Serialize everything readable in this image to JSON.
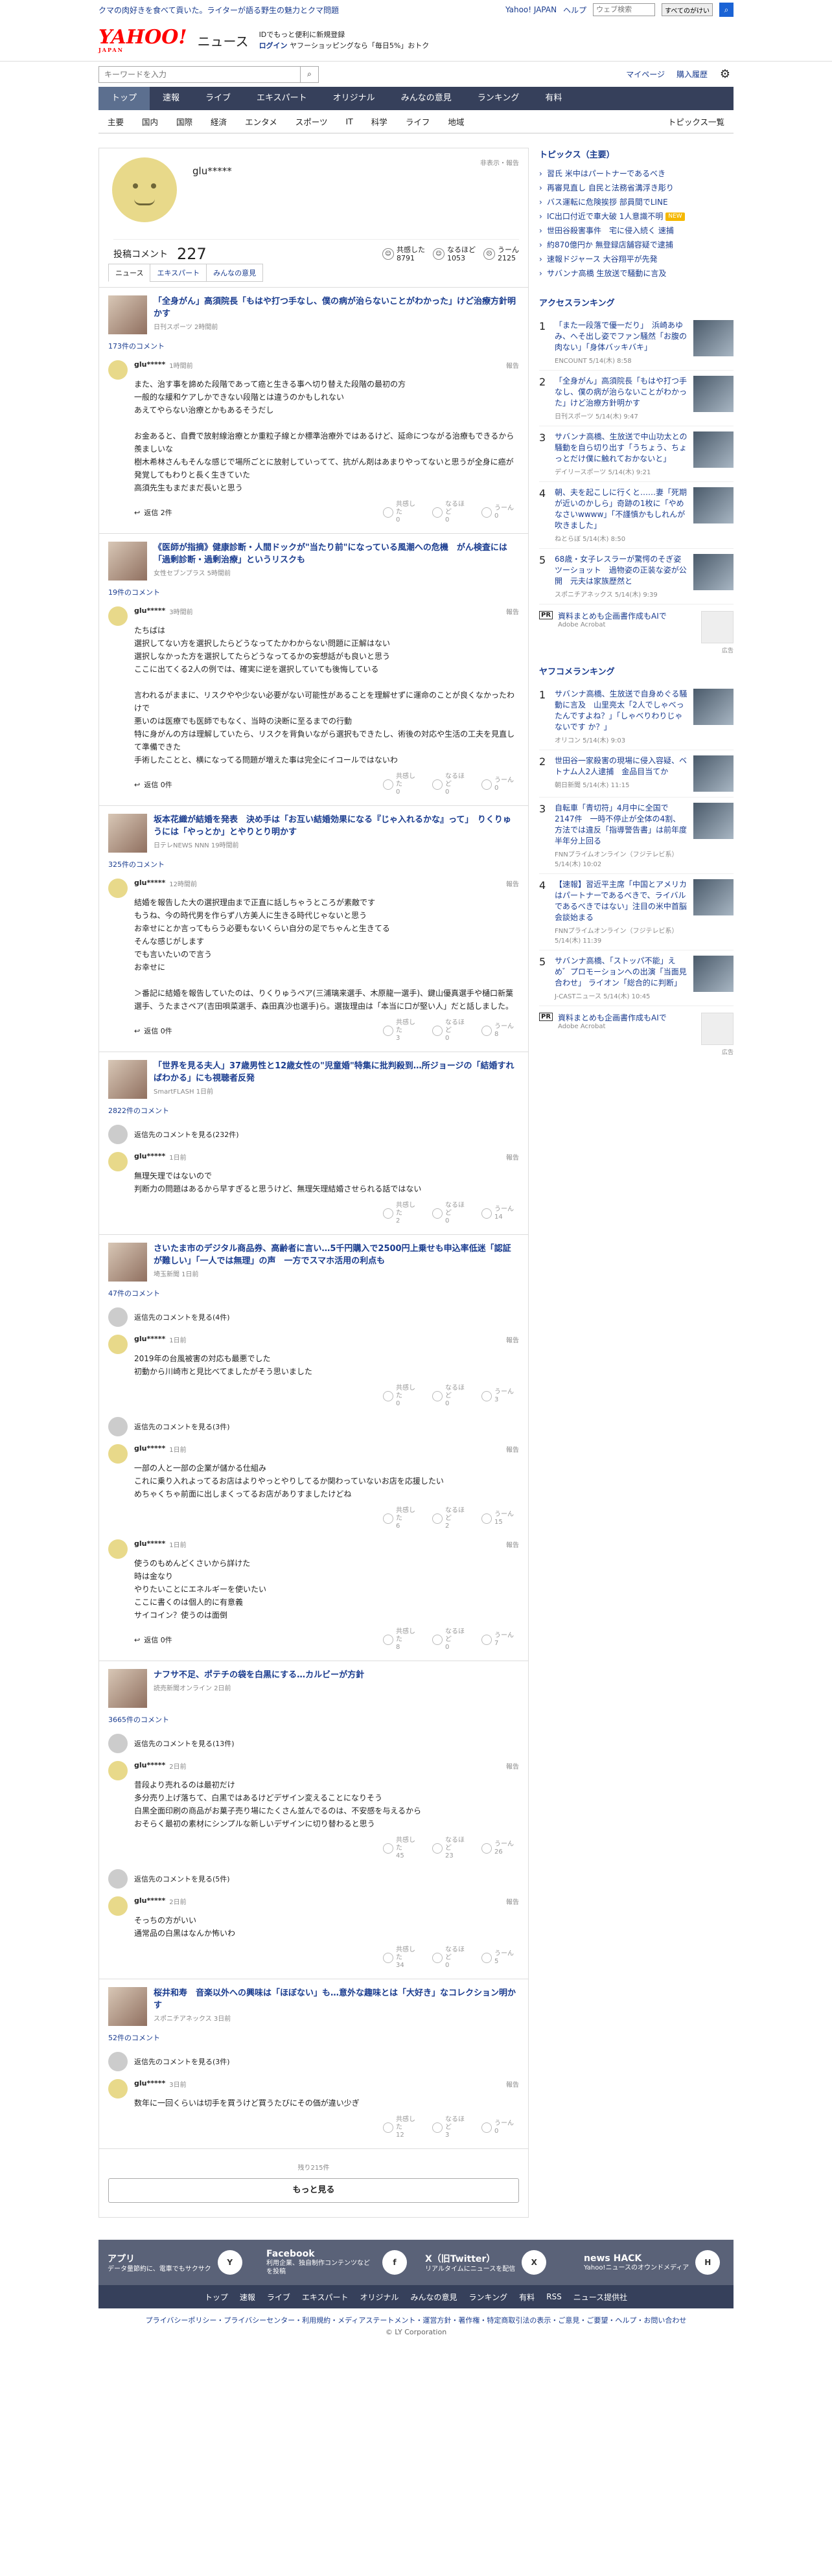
{
  "top": {
    "ad": "クマの肉好きを食べて貢いた。ライターが語る野生の魅力とクマ問題",
    "yahoo_link": "Yahoo! JAPAN",
    "help": "ヘルプ",
    "search_placeholder": "ウェブ検索",
    "search_btn": "すべてのがけい"
  },
  "logo": {
    "main": "YAHOO!",
    "sub": "JAPAN",
    "news": "ニュース"
  },
  "login": {
    "line1": "IDでもっと便利に新規登録",
    "login": "ログイン",
    "line2": "ヤフーショッピングなら「毎日5%」おトク"
  },
  "search": {
    "placeholder": "キーワードを入力",
    "mypage": "マイページ",
    "history": "購入履歴"
  },
  "mainnav": [
    "トップ",
    "速報",
    "ライブ",
    "エキスパート",
    "オリジナル",
    "みんなの意見",
    "ランキング",
    "有料"
  ],
  "subnav": [
    "主要",
    "国内",
    "国際",
    "経済",
    "エンタメ",
    "スポーツ",
    "IT",
    "科学",
    "ライフ",
    "地域"
  ],
  "subnav_right": "トピックス一覧",
  "profile": {
    "name": "glu*****",
    "report": "非表示・報告",
    "label": "投稿コメント",
    "count": "227",
    "r1": "共感した",
    "v1": "8791",
    "r2": "なるほど",
    "v2": "1053",
    "r3": "うーん",
    "v3": "2125"
  },
  "tabs": [
    "ニュース",
    "エキスパート",
    "みんなの意見"
  ],
  "threads": [
    {
      "title": "「全身がん」高須院長「もはや打つ手なし、僕の病が治らないことがわかった」けど治療方針明かす",
      "src": "日刊スポーツ 2時間前",
      "count": "173件のコメント",
      "comments": [
        {
          "user": "glu*****",
          "time": "1時間前",
          "text": "また、治す事を諦めた段階であって癌と生きる事へ切り替えた段階の最初の方\n一般的な緩和ケアしかできない段階とは違うのかもしれない\nあえてやらない治療とかもあるそうだし\n\nお金あると、自費で放射線治療とか重粒子線とか標準治療外ではあるけど、延命につながる治療もできるから羨ましいな\n樹木希林さんもそんな感じで場所ごとに放射していってて、抗がん剤はあまりやってないと思うが全身に癌が発覚してもわりと長く生きていた\n高須先生もまだまだ長いと思う",
          "reply": "返信 2件",
          "a": "0",
          "b": "0",
          "c": "0"
        }
      ]
    },
    {
      "title": "《医師が指摘》健康診断・人間ドックが\"当たり前\"になっている風潮への危機　がん検査には「過剰診断・過剰治療」というリスクも",
      "src": "女性セブンプラス 5時間前",
      "count": "19件のコメント",
      "comments": [
        {
          "user": "glu*****",
          "time": "3時間前",
          "text": "たちばは\n選択してない方を選択したらどうなってたかわからない問題に正解はない\n選択しなかった方を選択してたらどうなってるかの妄想話がも良いと思う\nここに出てくる2人の例では、確実に逆を選択していても後悔している\n\n言われるがままに、リスクやや少ない必要がない可能性があることを理解せずに運命のことが良くなかったわけで\n悪いのは医療でも医師でもなく、当時の決断に至るまでの行動\n特に身がんの方は理解していたら、リスクを背負いながら選択もできたし、術後の対応や生活の工夫を見直して準備できた\n手術したことと、横になってる問題が増えた事は完全にイコールではないわ",
          "reply": "返信 0件",
          "a": "0",
          "b": "0",
          "c": "0"
        }
      ]
    },
    {
      "title": "坂本花織が結婚を発表　決め手は「お互い結婚効果になる『じゃ入れるかな』って」　りくりゅうには「やっとか」とやりとり明かす",
      "src": "日テレNEWS NNN 19時間前",
      "count": "325件のコメント",
      "comments": [
        {
          "user": "glu*****",
          "time": "12時間前",
          "text": "結婚を報告した大の選択理由まで正直に話しちゃうところが素敵です\nもうね、今の時代男を作らず八方美人に生きる時代じゃないと思う\nお幸せにとか言ってもらう必要もないくらい自分の足でちゃんと生きてる\nそんな感じがします\nでも言いたいので言う\nお幸せに\n\n＞番記に結婚を報告していたのは、りくりゅうペア(三浦璃来選手、木原龍一選手)、鍵山優真選手や樋口新葉選手、うたまさペア(吉田唄菜選手、森田真沙也選手)ら。選抜理由は「本当に口が堅い人」だと話しました。",
          "reply": "返信 0件",
          "a": "3",
          "b": "0",
          "c": "8"
        }
      ]
    },
    {
      "title": "「世界を見る夫人」37歳男性と12歳女性の\"児童婚\"特集に批判殺到…所ジョージの「結婚すればわかる」にも視聴者反発",
      "src": "SmartFLASH 1日前",
      "count": "2822件のコメント",
      "hidden": "返信先のコメントを見る(232件)",
      "comments": [
        {
          "user": "glu*****",
          "time": "1日前",
          "text": "無理矢理ではないので\n判断力の問題はあるから早すぎると思うけど、無理矢理結婚させられる話ではない",
          "reply": "",
          "a": "2",
          "b": "0",
          "c": "14"
        }
      ]
    },
    {
      "title": "さいたま市のデジタル商品券、高齢者に言い…5千円購入で2500円上乗せも申込率低迷「認証が難しい」「一人では無理」の声　一方でスマホ活用の利点も",
      "src": "埼玉新聞 1日前",
      "count": "47件のコメント",
      "hidden": "返信先のコメントを見る(4件)",
      "comments": [
        {
          "user": "glu*****",
          "time": "1日前",
          "text": "2019年の台風被害の対応も最悪でした\n初動から川崎市と見比べてましたがそう思いました",
          "reply": "",
          "a": "0",
          "b": "0",
          "c": "3"
        },
        {
          "hidden": "返信先のコメントを見る(3件)",
          "user": "glu*****",
          "time": "1日前",
          "text": "一部の人と一部の企業が儲かる仕組み\nこれに乗り入れよってるお店はよりやっとやりしてるか関わっていないお店を応援したい\nめちゃくちゃ前面に出しまくってるお店がありすましたけどね",
          "reply": "",
          "a": "6",
          "b": "2",
          "c": "15"
        },
        {
          "user": "glu*****",
          "time": "1日前",
          "text": "使うのもめんどくさいから詳けた\n時は金なり\nやりたいことにエネルギーを使いたい\nここに書くのは個人的に有意義\nサイコイン？使うのは面倒",
          "reply": "返信 0件",
          "a": "8",
          "b": "0",
          "c": "7"
        }
      ]
    },
    {
      "title": "ナフサ不足、ポテチの袋を白黒にする…カルビーが方針",
      "src": "読売新聞オンライン 2日前",
      "count": "3665件のコメント",
      "hidden": "返信先のコメントを見る(13件)",
      "comments": [
        {
          "user": "glu*****",
          "time": "2日前",
          "text": "昔段より売れるのは最初だけ\n多分売り上げ落ちて、白黒ではあるけどデザイン変えることになりそう\n白黒全面印刷の商品がお菓子売り場にたくさん並んでるのは、不安感を与えるから\nおそらく最初の素材にシンプルな新しいデザインに切り替わると思う",
          "reply": "",
          "a": "45",
          "b": "23",
          "c": "26"
        },
        {
          "hidden": "返信先のコメントを見る(5件)",
          "user": "glu*****",
          "time": "2日前",
          "text": "そっちの方がいい\n通常品の白黒はなんか怖いわ",
          "reply": "",
          "a": "34",
          "b": "0",
          "c": "5"
        }
      ]
    },
    {
      "title": "桜井和寿　音楽以外への興味は「ほぼない」も…意外な趣味とは「大好き」なコレクション明かす",
      "src": "スポニチアネックス 3日前",
      "count": "52件のコメント",
      "hidden": "返信先のコメントを見る(3件)",
      "comments": [
        {
          "user": "glu*****",
          "time": "3日前",
          "text": "数年に一回くらいは切手を買うけど買うたびにその価が違い少ぎ",
          "reply": "",
          "a": "12",
          "b": "3",
          "c": "0"
        }
      ]
    }
  ],
  "more": {
    "remaining": "残り215件",
    "button": "もっと見る"
  },
  "topics": {
    "title": "トピックス（主要）",
    "items": [
      {
        "t": "習氏 米中はパートナーであるべき",
        "b": ""
      },
      {
        "t": "再審見直し 自民と法務省溝浮き彫り",
        "b": ""
      },
      {
        "t": "バス運転に危険挨拶 部員間でLINE",
        "b": ""
      },
      {
        "t": "IC出口付近で車大破 1人意識不明",
        "b": "NEW"
      },
      {
        "t": "世田谷殺害事件　宅に侵入続く 速捕",
        "b": ""
      },
      {
        "t": "約870億円か 無登録店舗容疑で逮捕",
        "b": ""
      },
      {
        "t": "速報ドジャース 大谷翔平が先発",
        "b": ""
      },
      {
        "t": "サバンナ高橋 生放送で騒動に言及",
        "b": ""
      }
    ]
  },
  "access": {
    "title": "アクセスランキング",
    "items": [
      {
        "t": "「また一段落で優一だり」　浜崎あゆみ、へそ出し姿でファン騒然「お腹の肉ない」「身体バッキバキ」",
        "s": "ENCOUNT 5/14(木) 8:58"
      },
      {
        "t": "「全身がん」高須院長「もはや打つ手なし、僕の病が治らないことがわかった」けど治療方針明かす",
        "s": "日刊スポーツ 5/14(木) 9:47"
      },
      {
        "t": "サバンナ高橋、生放送で中山功太との騒動を自ら切り出す「うちょう、ちょっとだけ僕に触れておかないと」",
        "s": "デイリースポーツ 5/14(木) 9:21"
      },
      {
        "t": "朝、夫を起こしに行くと……妻「死期が近いのかしら」奇跡の1枚に「やめなさいwwww」「不謹慎かもしれんが吹きました」",
        "s": "ねとらぼ 5/14(木) 8:50"
      },
      {
        "t": "68歳・女子レスラーが驚愕のそぎ姿ツーショット　過物姿の正装な姿が公開　元夫は家族歴然と",
        "s": "スポニチアネックス 5/14(木) 9:39"
      }
    ]
  },
  "pr1": {
    "label": "PR",
    "t": "資料まとめも企画書作成もAIで",
    "s": "Adobe Acrobat"
  },
  "adinfo": "広告",
  "yafoco": {
    "title": "ヤフコメランキング",
    "items": [
      {
        "t": "サバンナ高橋、生放送で自身めぐる騒動に言及　山里亮太「2人でしゃべったんですよね？」「しゃべりわりじゃないです か？」",
        "s": "オリコン 5/14(木) 9:03"
      },
      {
        "t": "世田谷一家殺害の現場に侵入容疑、ベトナム人2人逮捕　金品目当てか",
        "s": "朝日新聞 5/14(木) 11:15"
      },
      {
        "t": "自転車「青切符」4月中に全国で2147件　一時不停止が全体の4割、方法では違反「指導警告書」は前年度半年分上回る",
        "s": "FNNプライムオンライン（フジテレビ系） 5/14(木) 10:02"
      },
      {
        "t": "【速報】習近平主席「中国とアメリカはパートナーであるべきで、ライバルであるべきではない」注目の米中首脳会談始まる",
        "s": "FNNプライムオンライン（フジテレビ系） 5/14(木) 11:39"
      },
      {
        "t": "サバンナ高橋、「ストッパ不能」えめ゛プロモーションへの出演「当面見合わせ」 ライオン「総合的に判断」",
        "s": "J-CASTニュース 5/14(木) 10:45"
      }
    ]
  },
  "pr2": {
    "label": "PR",
    "t": "資料まとめも企画書作成もAIで",
    "s": "Adobe Acrobat"
  },
  "apps": [
    {
      "nm": "アプリ",
      "ds": "データ量節約に、電車でもサクサク",
      "ic": "Y"
    },
    {
      "nm": "Facebook",
      "ds": "利用企業、独自制作コンテンツなどを投稿",
      "ic": "f"
    },
    {
      "nm": "X（旧Twitter）",
      "ds": "リアルタイムにニュースを配信",
      "ic": "X"
    },
    {
      "nm": "news HACK",
      "ds": "Yahoo!ニュースのオウンドメディア",
      "ic": "H"
    }
  ],
  "footnav": [
    "トップ",
    "速報",
    "ライブ",
    "エキスパート",
    "オリジナル",
    "みんなの意見",
    "ランキング",
    "有料",
    "RSS",
    "ニュース提供社"
  ],
  "legal": "プライバシーポリシー・プライバシーセンター・利用規約・メディアステートメント・運営方針・著作権・特定商取引法の表示・ご意見・ご要望・ヘルプ・お問い合わせ",
  "copy": "© LY Corporation"
}
